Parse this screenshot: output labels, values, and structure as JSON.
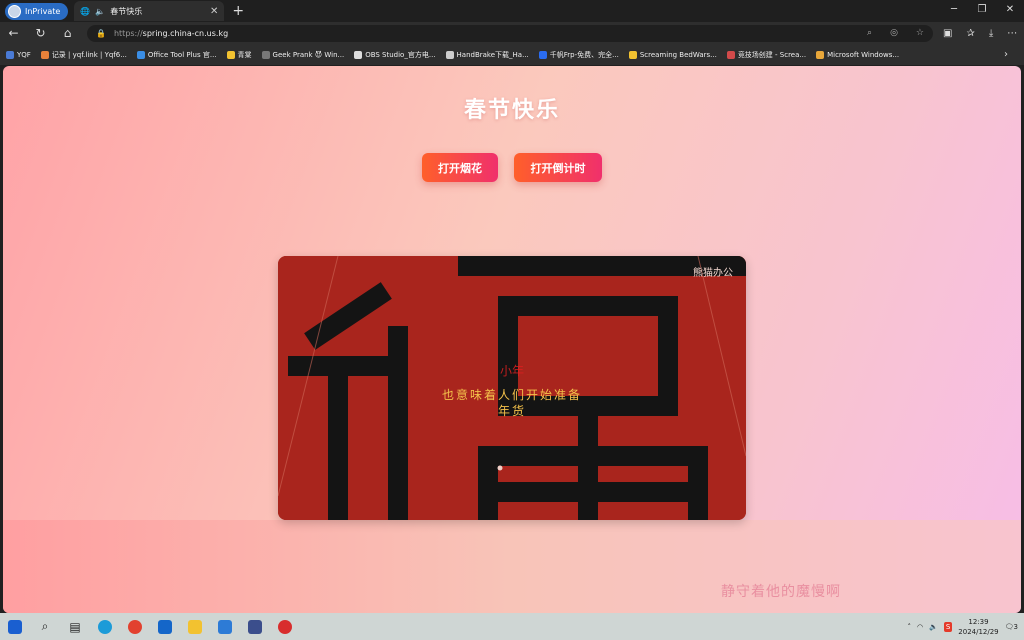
{
  "browser": {
    "inprivate_label": "InPrivate",
    "tab_title": "春节快乐",
    "url_protocol": "https://",
    "url_host": "spring.china-cn.us.kg"
  },
  "bookmarks": [
    {
      "label": "YQF",
      "color": "#4a7bd6"
    },
    {
      "label": "记录 | yqf.link | Yqf6...",
      "color": "#e8823a"
    },
    {
      "label": "Office Tool Plus 官...",
      "color": "#3a8ee6"
    },
    {
      "label": "青棠",
      "color": "#f2c230"
    },
    {
      "label": "Geek Prank 😈 Win...",
      "color": "#777777"
    },
    {
      "label": "OBS Studio_官方电...",
      "color": "#dddddd"
    },
    {
      "label": "HandBrake下载_Ha...",
      "color": "#cccccc"
    },
    {
      "label": "千帆Frp-免费、完全...",
      "color": "#2a6cf0"
    },
    {
      "label": "Screaming BedWars...",
      "color": "#f2c230"
    },
    {
      "label": "竞技场创建 - Screa...",
      "color": "#d24a4a"
    },
    {
      "label": "Microsoft Windows...",
      "color": "#e8a73a"
    }
  ],
  "page": {
    "title": "春节快乐",
    "buttons": [
      "打开烟花",
      "打开倒计时"
    ],
    "signature": "静守着他的魔慢啊"
  },
  "video": {
    "watermark": "熊猫办公",
    "subtitle_red": "小年",
    "subtitle_line1": "也意味着人们开始准备",
    "subtitle_line2": "年货"
  },
  "taskbar": {
    "time": "12:39",
    "date": "2024/12/29",
    "notifications": "3"
  }
}
